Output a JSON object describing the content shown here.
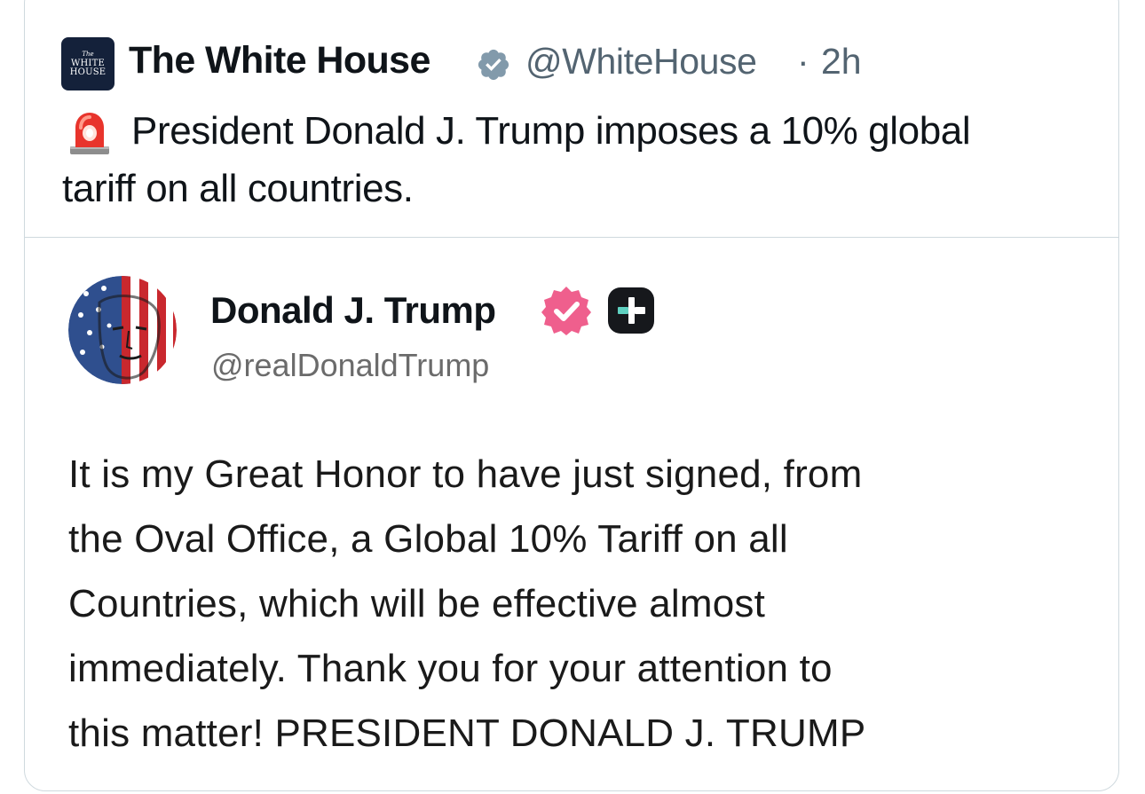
{
  "outer_post": {
    "avatar_lines": [
      "The",
      "WHITE",
      "HOUSE"
    ],
    "display_name": "The White House",
    "handle": "@WhiteHouse",
    "separator": "·",
    "time": "2h",
    "text_lines": [
      "President Donald J. Trump imposes a 10% global",
      "tariff on all countries."
    ],
    "emoji": "rotating-light-icon"
  },
  "quoted_post": {
    "display_name": "Donald J. Trump",
    "handle": "@realDonaldTrump",
    "body_lines": [
      "It is my Great Honor to have just signed, from",
      "the Oval Office, a Global 10% Tariff on all",
      "Countries, which will be effective almost",
      "immediately. Thank you for your attention to",
      "this matter! PRESIDENT DONALD J. TRUMP"
    ]
  },
  "colors": {
    "verified_grey": "#829aab",
    "verified_pink": "#ef5f8d",
    "text_primary": "#0f1419",
    "text_secondary": "#536471",
    "border": "#cfd9de"
  }
}
